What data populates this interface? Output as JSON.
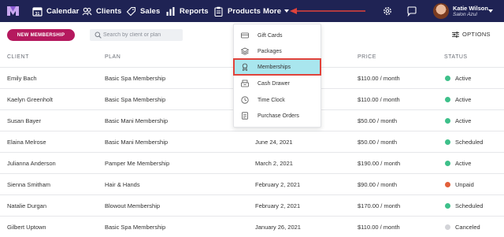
{
  "nav": {
    "items": [
      {
        "label": "Calendar",
        "icon": "calendar-icon"
      },
      {
        "label": "Clients",
        "icon": "users-icon"
      },
      {
        "label": "Sales",
        "icon": "tag-icon"
      },
      {
        "label": "Reports",
        "icon": "chart-icon"
      },
      {
        "label": "Products",
        "icon": "clipboard-icon"
      },
      {
        "label": "More",
        "icon": "caret-down-icon"
      }
    ],
    "user": {
      "name": "Katie Wilson",
      "business": "Salon Azul"
    },
    "colors": {
      "bar": "#1f2354",
      "arrow": "#e0433b"
    }
  },
  "toolbar": {
    "new_button": "NEW MEMBERSHIP",
    "search_placeholder": "Search by client or plan",
    "options_label": "OPTIONS"
  },
  "table": {
    "headers": {
      "client": "CLIENT",
      "plan": "PLAN",
      "price": "PRICE",
      "status": "STATUS"
    },
    "rows": [
      {
        "client": "Emily Bach",
        "plan": "Basic Spa Membership",
        "date": "",
        "price": "$110.00 / month",
        "status": "Active",
        "status_color": "#3ec08a"
      },
      {
        "client": "Kaelyn Greenholt",
        "plan": "Basic Spa Membership",
        "date": "",
        "price": "$110.00 / month",
        "status": "Active",
        "status_color": "#3ec08a"
      },
      {
        "client": "Susan Bayer",
        "plan": "Basic Mani Membership",
        "date": "",
        "price": "$50.00 / month",
        "status": "Active",
        "status_color": "#3ec08a"
      },
      {
        "client": "Elaina Melrose",
        "plan": "Basic Mani Membership",
        "date": "June 24, 2021",
        "price": "$50.00 / month",
        "status": "Scheduled",
        "status_color": "#3ec08a"
      },
      {
        "client": "Julianna Anderson",
        "plan": "Pamper Me Membership",
        "date": "March 2, 2021",
        "price": "$190.00 / month",
        "status": "Active",
        "status_color": "#3ec08a"
      },
      {
        "client": "Sienna Smitham",
        "plan": "Hair & Hands",
        "date": "February 2, 2021",
        "price": "$90.00 / month",
        "status": "Unpaid",
        "status_color": "#e2603b"
      },
      {
        "client": "Natalie Durgan",
        "plan": "Blowout Membership",
        "date": "February 2, 2021",
        "price": "$170.00 / month",
        "status": "Scheduled",
        "status_color": "#3ec08a"
      },
      {
        "client": "Gilbert Uptown",
        "plan": "Basic Spa Membership",
        "date": "January 26, 2021",
        "price": "$110.00 / month",
        "status": "Canceled",
        "status_color": "#d3d4d8"
      }
    ]
  },
  "more_menu": {
    "items": [
      {
        "label": "Gift Cards",
        "icon": "gift-card-icon"
      },
      {
        "label": "Packages",
        "icon": "layers-icon"
      },
      {
        "label": "Memberships",
        "icon": "membership-badge-icon",
        "highlighted": true
      },
      {
        "label": "Cash Drawer",
        "icon": "cash-drawer-icon"
      },
      {
        "label": "Time Clock",
        "icon": "clock-icon"
      },
      {
        "label": "Purchase Orders",
        "icon": "purchase-orders-icon"
      }
    ],
    "highlight_color": "#a9e6ee"
  }
}
